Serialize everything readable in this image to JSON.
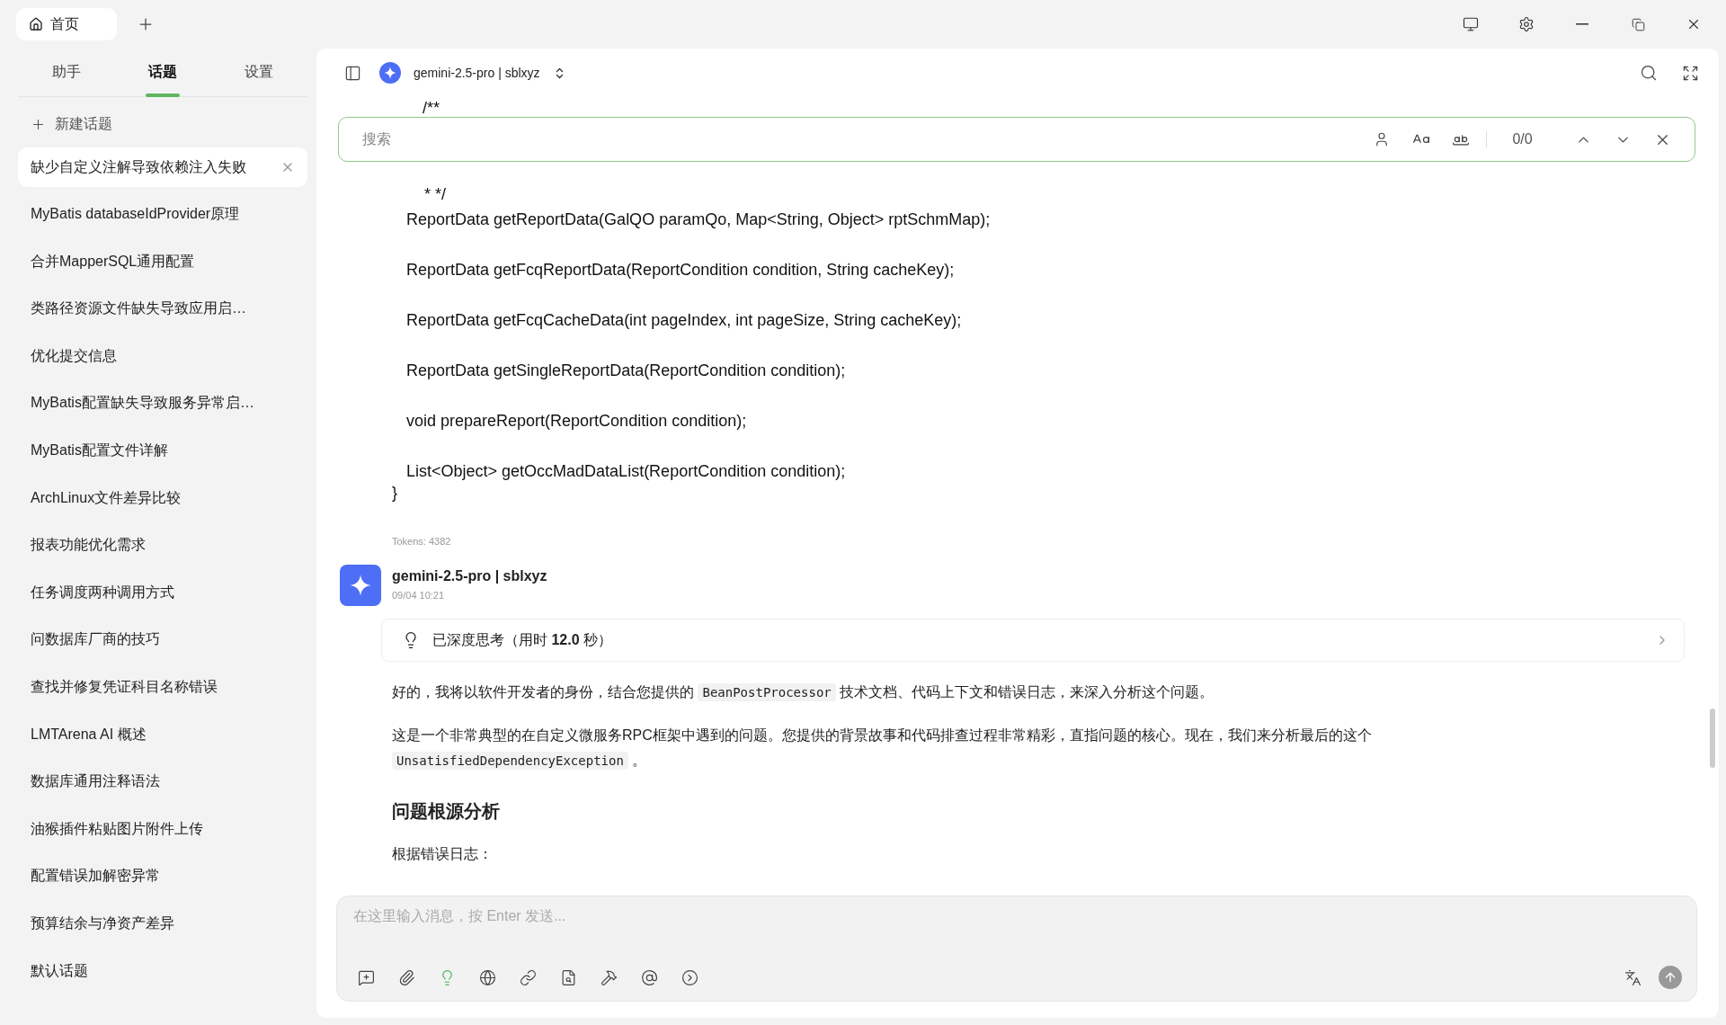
{
  "tab_bar": {
    "tabs": [
      {
        "label": "首页",
        "selected": true
      }
    ]
  },
  "sidebar": {
    "tabs": [
      {
        "label": "助手",
        "selected": false
      },
      {
        "label": "话题",
        "selected": true
      },
      {
        "label": "设置",
        "selected": false
      }
    ],
    "new_topic": "新建话题",
    "topics": [
      {
        "label": "缺少自定义注解导致依赖注入失败",
        "selected": true
      },
      {
        "label": "MyBatis databaseIdProvider原理",
        "selected": false
      },
      {
        "label": "合并MapperSQL通用配置",
        "selected": false
      },
      {
        "label": "类路径资源文件缺失导致应用启…",
        "selected": false
      },
      {
        "label": "优化提交信息",
        "selected": false
      },
      {
        "label": "MyBatis配置缺失导致服务异常启…",
        "selected": false
      },
      {
        "label": "MyBatis配置文件详解",
        "selected": false
      },
      {
        "label": "ArchLinux文件差异比较",
        "selected": false
      },
      {
        "label": "报表功能优化需求",
        "selected": false
      },
      {
        "label": "任务调度两种调用方式",
        "selected": false
      },
      {
        "label": "问数据库厂商的技巧",
        "selected": false
      },
      {
        "label": "查找并修复凭证科目名称错误",
        "selected": false
      },
      {
        "label": "LMTArena AI 概述",
        "selected": false
      },
      {
        "label": "数据库通用注释语法",
        "selected": false
      },
      {
        "label": "油猴插件粘贴图片附件上传",
        "selected": false
      },
      {
        "label": "配置错误加解密异常",
        "selected": false
      },
      {
        "label": "预算结余与净资产差异",
        "selected": false
      },
      {
        "label": "默认话题",
        "selected": false
      }
    ]
  },
  "header": {
    "model": "gemini-2.5-pro | sblxyz"
  },
  "find_bar": {
    "placeholder": "搜索",
    "count": "0/0"
  },
  "code": {
    "comment_open": "/**",
    "comment_close": "* */",
    "lines": [
      "ReportData getReportData(GalQO paramQo, Map<String, Object> rptSchmMap);",
      "ReportData getFcqReportData(ReportCondition condition, String cacheKey);",
      "ReportData getFcqCacheData(int pageIndex, int pageSize, String cacheKey);",
      "ReportData getSingleReportData(ReportCondition condition);",
      "void prepareReport(ReportCondition condition);",
      "List<Object> getOccMadDataList(ReportCondition condition);"
    ],
    "closing": "}"
  },
  "tokens": "Tokens: 4382",
  "message": {
    "author": "gemini-2.5-pro | sblxyz",
    "time": "09/04 10:21",
    "thinking": "已深度思考（用时 **12.0** 秒）",
    "blocks": [
      {
        "kind": "paragraph",
        "parts": [
          {
            "kind": "text",
            "text": "好的，我将以软件开发者的身份，结合您提供的 "
          },
          {
            "kind": "code",
            "text": "BeanPostProcessor"
          },
          {
            "kind": "text",
            "text": " 技术文档、代码上下文和错误日志，来深入分析这个问题。"
          }
        ]
      },
      {
        "kind": "paragraph",
        "parts": [
          {
            "kind": "text",
            "text": "这是一个非常典型的在自定义微服务RPC框架中遇到的问题。您提供的背景故事和代码排查过程非常精彩，直指问题的核心。现在，我们来分析最后的这个 "
          },
          {
            "kind": "code",
            "text": "UnsatisfiedDependencyException"
          },
          {
            "kind": "text",
            "text": " 。"
          }
        ]
      },
      {
        "kind": "heading",
        "parts": [
          {
            "kind": "text",
            "text": "问题根源分析"
          }
        ]
      },
      {
        "kind": "paragraph",
        "parts": [
          {
            "kind": "text",
            "text": "根据错误日志："
          }
        ]
      }
    ]
  },
  "composer": {
    "placeholder": "在这里输入消息，按 Enter 发送...",
    "tools": [
      {
        "kind": "new-topic",
        "on": false
      },
      {
        "kind": "attach",
        "on": false
      },
      {
        "kind": "think",
        "on": true
      },
      {
        "kind": "web",
        "on": false
      },
      {
        "kind": "link",
        "on": false
      },
      {
        "kind": "file-search",
        "on": false
      },
      {
        "kind": "tools",
        "on": false
      },
      {
        "kind": "mention",
        "on": false
      },
      {
        "kind": "more",
        "on": false
      }
    ]
  }
}
